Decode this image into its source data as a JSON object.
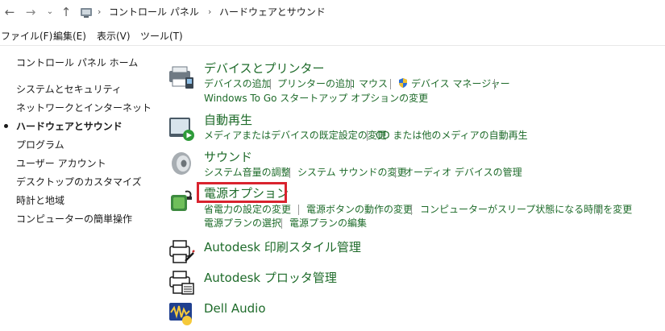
{
  "address": {
    "crumbs": [
      "コントロール パネル",
      "ハードウェアとサウンド"
    ],
    "sep": "›",
    "back_icon": "←",
    "forward_icon": "→",
    "recent_icon": "⌄",
    "up_icon": "↑"
  },
  "menu": [
    "ファイル(F)",
    "編集(E)",
    "表示(V)",
    "ツール(T)"
  ],
  "leftnav": {
    "home": "コントロール パネル ホーム",
    "items": [
      "システムとセキュリティ",
      "ネットワークとインターネット",
      "ハードウェアとサウンド",
      "プログラム",
      "ユーザー アカウント",
      "デスクトップのカスタマイズ",
      "時計と地域",
      "コンピューターの簡単操作"
    ]
  },
  "categories": [
    {
      "title": "デバイスとプリンター",
      "icon": "printer-devices-icon",
      "links": [
        "デバイスの追加",
        "プリンターの追加",
        "マウス",
        "デバイス マネージャー"
      ],
      "links2": [
        "Windows To Go スタートアップ オプションの変更"
      ]
    },
    {
      "title": "自動再生",
      "icon": "autoplay-icon",
      "links": [
        "メディアまたはデバイスの既定設定の変更",
        "CD または他のメディアの自動再生"
      ]
    },
    {
      "title": "サウンド",
      "icon": "speaker-icon",
      "links": [
        "システム音量の調整",
        "システム サウンドの変更",
        "オーディオ デバイスの管理"
      ]
    },
    {
      "title": "電源オプション",
      "icon": "power-options-icon",
      "links": [
        "省電力の設定の変更",
        "電源ボタンの動作の変更",
        "コンピューターがスリープ状態になる時間を変更"
      ],
      "links2": [
        "電源プランの選択",
        "電源プランの編集"
      ]
    },
    {
      "title": "Autodesk 印刷スタイル管理",
      "icon": "autodesk-print-style-icon"
    },
    {
      "title": "Autodesk プロッタ管理",
      "icon": "autodesk-plotter-icon"
    },
    {
      "title": "Dell Audio",
      "icon": "dell-audio-icon"
    }
  ],
  "colors": {
    "link": "#1e6b2a",
    "highlight": "#d9232e"
  }
}
